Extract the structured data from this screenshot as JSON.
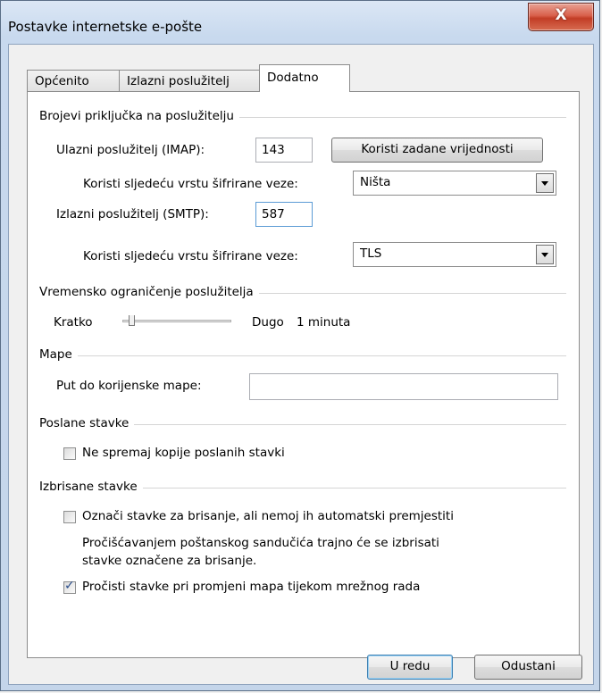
{
  "window": {
    "title": "Postavke internetske e-pošte",
    "close_label": "X"
  },
  "tabs": [
    {
      "label": "Općenito",
      "active": false
    },
    {
      "label": "Izlazni poslužitelj",
      "active": false
    },
    {
      "label": "Dodatno",
      "active": true
    }
  ],
  "ports": {
    "section_label": "Brojevi priključka na poslužitelju",
    "incoming_label": "Ulazni poslužitelj (IMAP):",
    "incoming_value": "143",
    "defaults_button": "Koristi zadane vrijednosti",
    "incoming_enc_label": "Koristi sljedeću vrstu šifrirane veze:",
    "incoming_enc_value": "Ništa",
    "outgoing_label": "Izlazni poslužitelj (SMTP):",
    "outgoing_value": "587",
    "outgoing_enc_label": "Koristi sljedeću vrstu šifrirane veze:",
    "outgoing_enc_value": "TLS"
  },
  "timeout": {
    "section_label": "Vremensko ograničenje poslužitelja",
    "short_label": "Kratko",
    "long_label": "Dugo",
    "value_label": "1 minuta",
    "slider_position": 0.0
  },
  "folders": {
    "section_label": "Mape",
    "root_label": "Put do korijenske mape:",
    "root_value": ""
  },
  "sent": {
    "section_label": "Poslane stavke",
    "no_copy_label": "Ne spremaj kopije poslanih stavki",
    "no_copy_checked": false
  },
  "deleted": {
    "section_label": "Izbrisane stavke",
    "mark_label": "Označi stavke za brisanje, ali nemoj ih automatski premjestiti",
    "mark_checked": false,
    "note_line1": "Pročišćavanjem poštanskog sandučića trajno će se izbrisati",
    "note_line2": "stavke označene za brisanje.",
    "purge_label": "Pročisti stavke pri promjeni mapa tijekom mrežnog rada",
    "purge_checked": true
  },
  "footer": {
    "ok_label": "U redu",
    "cancel_label": "Odustani"
  }
}
